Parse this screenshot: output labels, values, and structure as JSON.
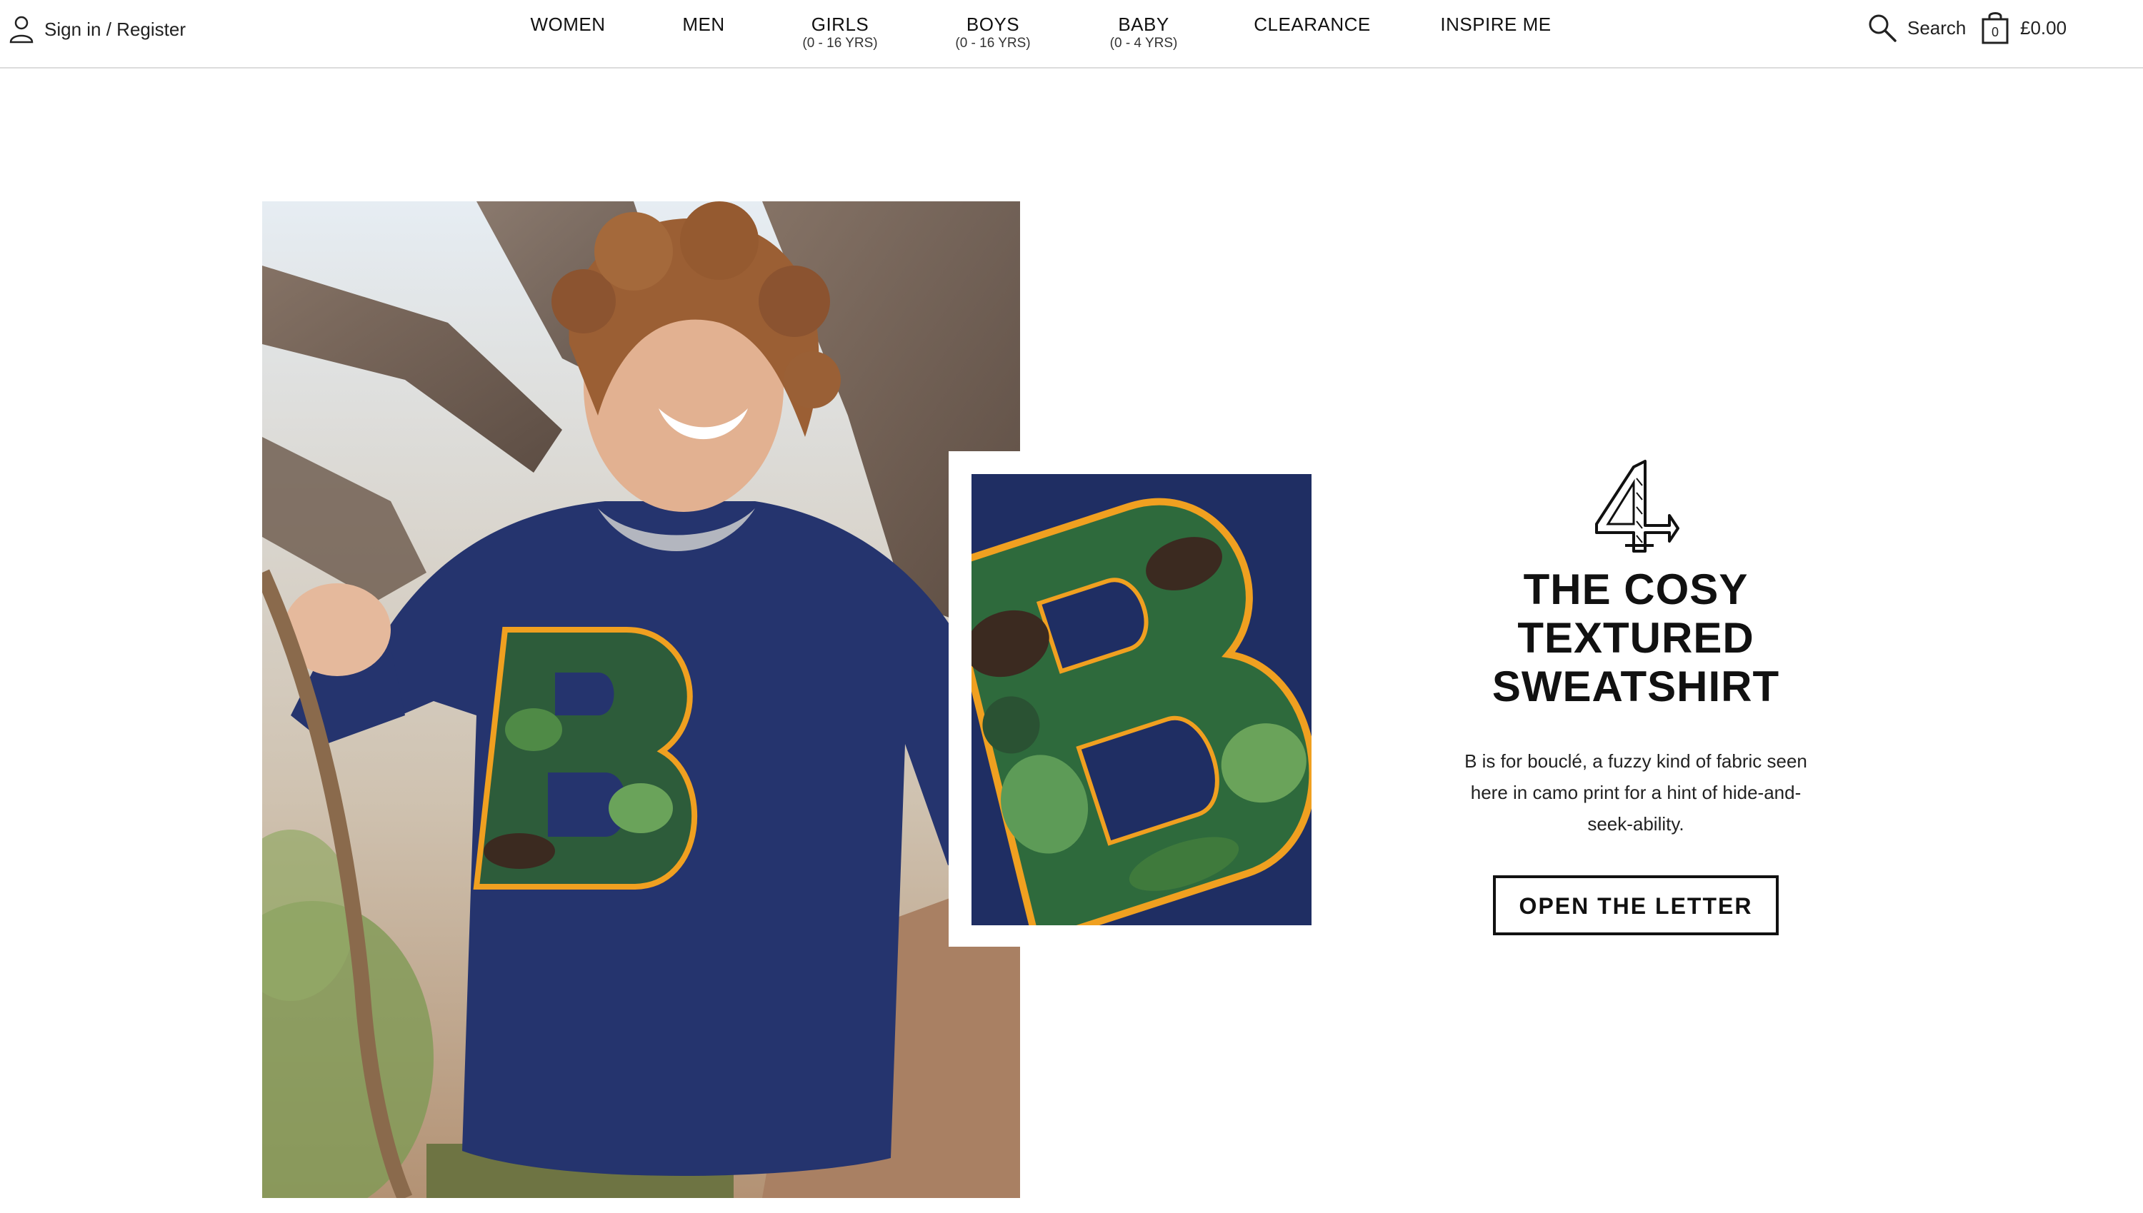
{
  "header": {
    "signin_label": "Sign in / Register",
    "nav": [
      {
        "label": "WOMEN",
        "sub": ""
      },
      {
        "label": "MEN",
        "sub": ""
      },
      {
        "label": "GIRLS",
        "sub": "(0 - 16 YRS)"
      },
      {
        "label": "BOYS",
        "sub": "(0 - 16 YRS)"
      },
      {
        "label": "BABY",
        "sub": "(0 - 4 YRS)"
      },
      {
        "label": "CLEARANCE",
        "sub": ""
      },
      {
        "label": "INSPIRE ME",
        "sub": ""
      }
    ],
    "search_label": "Search",
    "basket_total": "£0.00"
  },
  "feature": {
    "headline_lines": [
      "THE COSY",
      "TEXTURED",
      "SWEATSHIRT"
    ],
    "description": "B is for bouclé, a fuzzy kind of fabric seen here in camo print for a hint of hide-and-seek-ability.",
    "cta_label": "OPEN THE LETTER"
  },
  "icons": {
    "signin": "user-icon",
    "search": "search-icon",
    "basket": "shopping-bag-icon",
    "numeral": "decorative-numeral-4-icon"
  },
  "colors": {
    "sweatshirt_navy": "#25346e",
    "camo_green": "#3f7a3c",
    "letter_outline": "#f0a020",
    "text": "#111111"
  }
}
